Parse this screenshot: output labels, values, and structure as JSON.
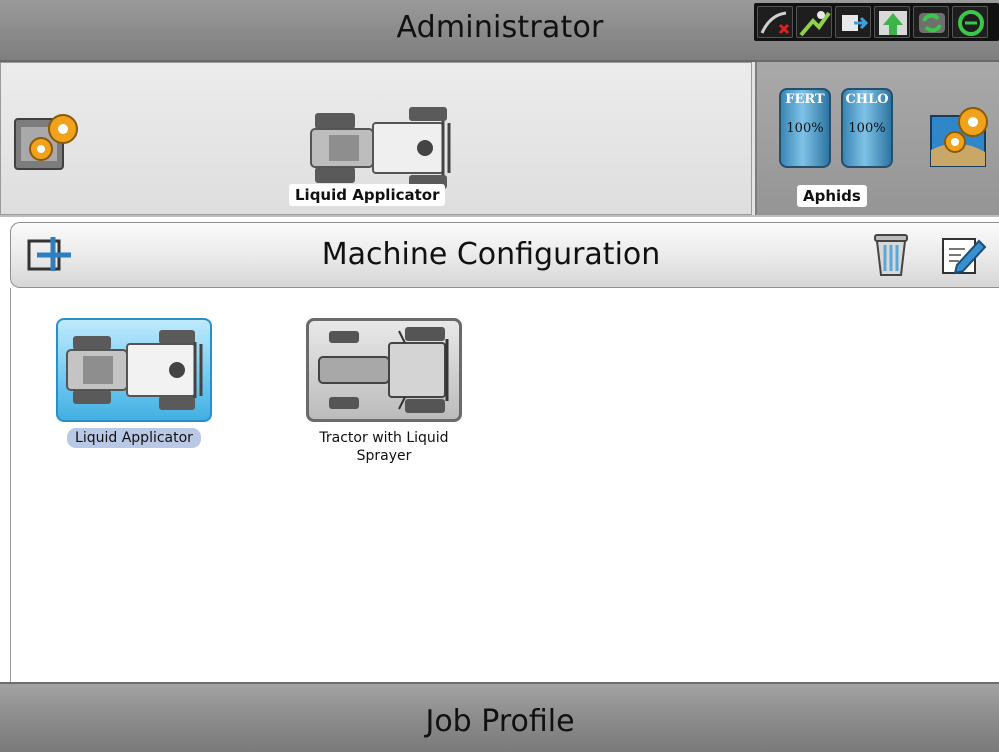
{
  "header": {
    "title": "Administrator",
    "status_icons": [
      "gps-signal-icon",
      "rtk-correction-icon",
      "data-transfer-icon",
      "guidance-icon",
      "section-control-icon",
      "connection-icon"
    ]
  },
  "active": {
    "machine_label": "Liquid Applicator",
    "product_label": "Aphids",
    "tanks": [
      {
        "name": "FERT",
        "level": "100%"
      },
      {
        "name": "CHLO",
        "level": "100%"
      }
    ]
  },
  "section": {
    "title": "Machine Configuration"
  },
  "machines": [
    {
      "label": "Liquid Applicator",
      "selected": true
    },
    {
      "label": "Tractor with Liquid Sprayer",
      "selected": false
    }
  ],
  "footer": {
    "title": "Job Profile"
  },
  "colors": {
    "selected_tile": "#70c8f0",
    "bar_gray": "#8a8a8a",
    "tank_blue": "#3b86b5"
  }
}
